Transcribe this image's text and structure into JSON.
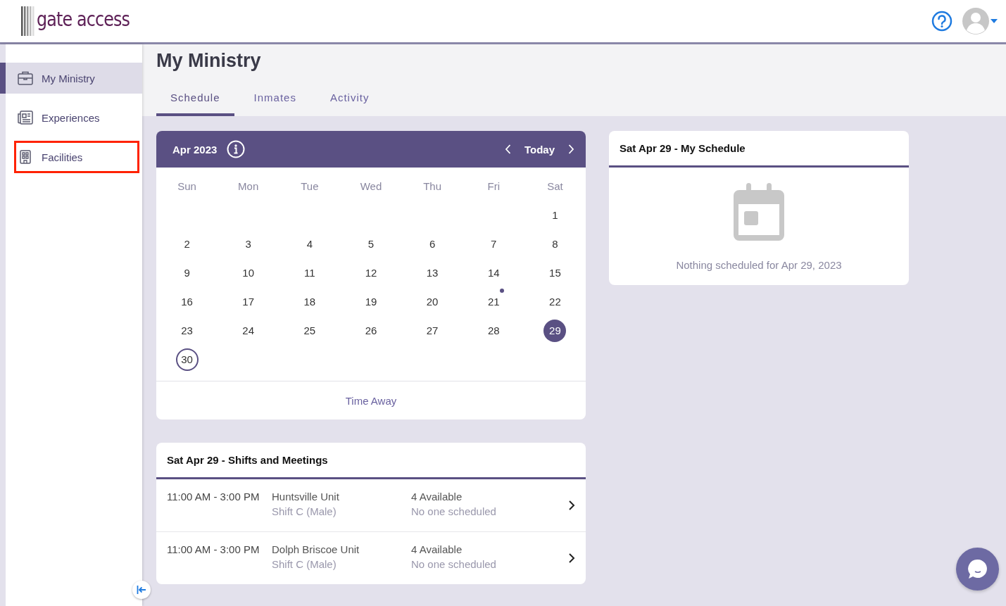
{
  "header": {
    "logo_text": "gate access"
  },
  "sidebar": {
    "items": [
      {
        "label": "My Ministry",
        "kind": "briefcase",
        "selected": true,
        "highlighted": false
      },
      {
        "label": "Experiences",
        "kind": "newspaper",
        "selected": false,
        "highlighted": false
      },
      {
        "label": "Facilities",
        "kind": "building",
        "selected": false,
        "highlighted": true
      }
    ]
  },
  "page": {
    "title": "My Ministry"
  },
  "tabs": [
    {
      "label": "Schedule",
      "selected": true
    },
    {
      "label": "Inmates",
      "selected": false
    },
    {
      "label": "Activity",
      "selected": false
    }
  ],
  "calendar": {
    "month": "Apr 2023",
    "today_label": "Today",
    "weekdays": [
      "Sun",
      "Mon",
      "Tue",
      "Wed",
      "Thu",
      "Fri",
      "Sat"
    ],
    "weeks": [
      [
        {
          "day": "1",
          "selected": false,
          "today": false,
          "event": false
        }
      ],
      [
        {
          "day": "2",
          "selected": false,
          "today": false,
          "event": false
        },
        {
          "day": "3",
          "selected": false,
          "today": false,
          "event": false
        },
        {
          "day": "4",
          "selected": false,
          "today": false,
          "event": false
        },
        {
          "day": "5",
          "selected": false,
          "today": false,
          "event": false
        },
        {
          "day": "6",
          "selected": false,
          "today": false,
          "event": false
        },
        {
          "day": "7",
          "selected": false,
          "today": false,
          "event": false
        },
        {
          "day": "8",
          "selected": false,
          "today": false,
          "event": false
        }
      ],
      [
        {
          "day": "9",
          "selected": false,
          "today": false,
          "event": false
        },
        {
          "day": "10",
          "selected": false,
          "today": false,
          "event": false
        },
        {
          "day": "11",
          "selected": false,
          "today": false,
          "event": false
        },
        {
          "day": "12",
          "selected": false,
          "today": false,
          "event": false
        },
        {
          "day": "13",
          "selected": false,
          "today": false,
          "event": false
        },
        {
          "day": "14",
          "selected": false,
          "today": false,
          "event": false
        },
        {
          "day": "15",
          "selected": false,
          "today": false,
          "event": false
        }
      ],
      [
        {
          "day": "16",
          "selected": false,
          "today": false,
          "event": false
        },
        {
          "day": "17",
          "selected": false,
          "today": false,
          "event": false
        },
        {
          "day": "18",
          "selected": false,
          "today": false,
          "event": false
        },
        {
          "day": "19",
          "selected": false,
          "today": false,
          "event": false
        },
        {
          "day": "20",
          "selected": false,
          "today": false,
          "event": false
        },
        {
          "day": "21",
          "selected": false,
          "today": false,
          "event": true
        },
        {
          "day": "22",
          "selected": false,
          "today": false,
          "event": false
        }
      ],
      [
        {
          "day": "23",
          "selected": false,
          "today": false,
          "event": false
        },
        {
          "day": "24",
          "selected": false,
          "today": false,
          "event": false
        },
        {
          "day": "25",
          "selected": false,
          "today": false,
          "event": false
        },
        {
          "day": "26",
          "selected": false,
          "today": false,
          "event": false
        },
        {
          "day": "27",
          "selected": false,
          "today": false,
          "event": false
        },
        {
          "day": "28",
          "selected": false,
          "today": false,
          "event": false
        },
        {
          "day": "29",
          "selected": true,
          "today": false,
          "event": false
        }
      ],
      [
        {
          "day": "30",
          "selected": false,
          "today": true,
          "event": false
        }
      ]
    ],
    "footer_link": "Time Away"
  },
  "shifts": {
    "title": "Sat Apr 29 - Shifts and Meetings",
    "rows": [
      {
        "time": "11:00 AM - 3:00 PM",
        "unit": "Huntsville Unit",
        "shift": "Shift C (Male)",
        "available": "4 Available",
        "scheduled": "No one scheduled"
      },
      {
        "time": "11:00 AM - 3:00 PM",
        "unit": "Dolph Briscoe Unit",
        "shift": "Shift C (Male)",
        "available": "4 Available",
        "scheduled": "No one scheduled"
      }
    ]
  },
  "my_schedule": {
    "title": "Sat Apr 29 - My Schedule",
    "empty_message": "Nothing scheduled for Apr 29, 2023"
  }
}
